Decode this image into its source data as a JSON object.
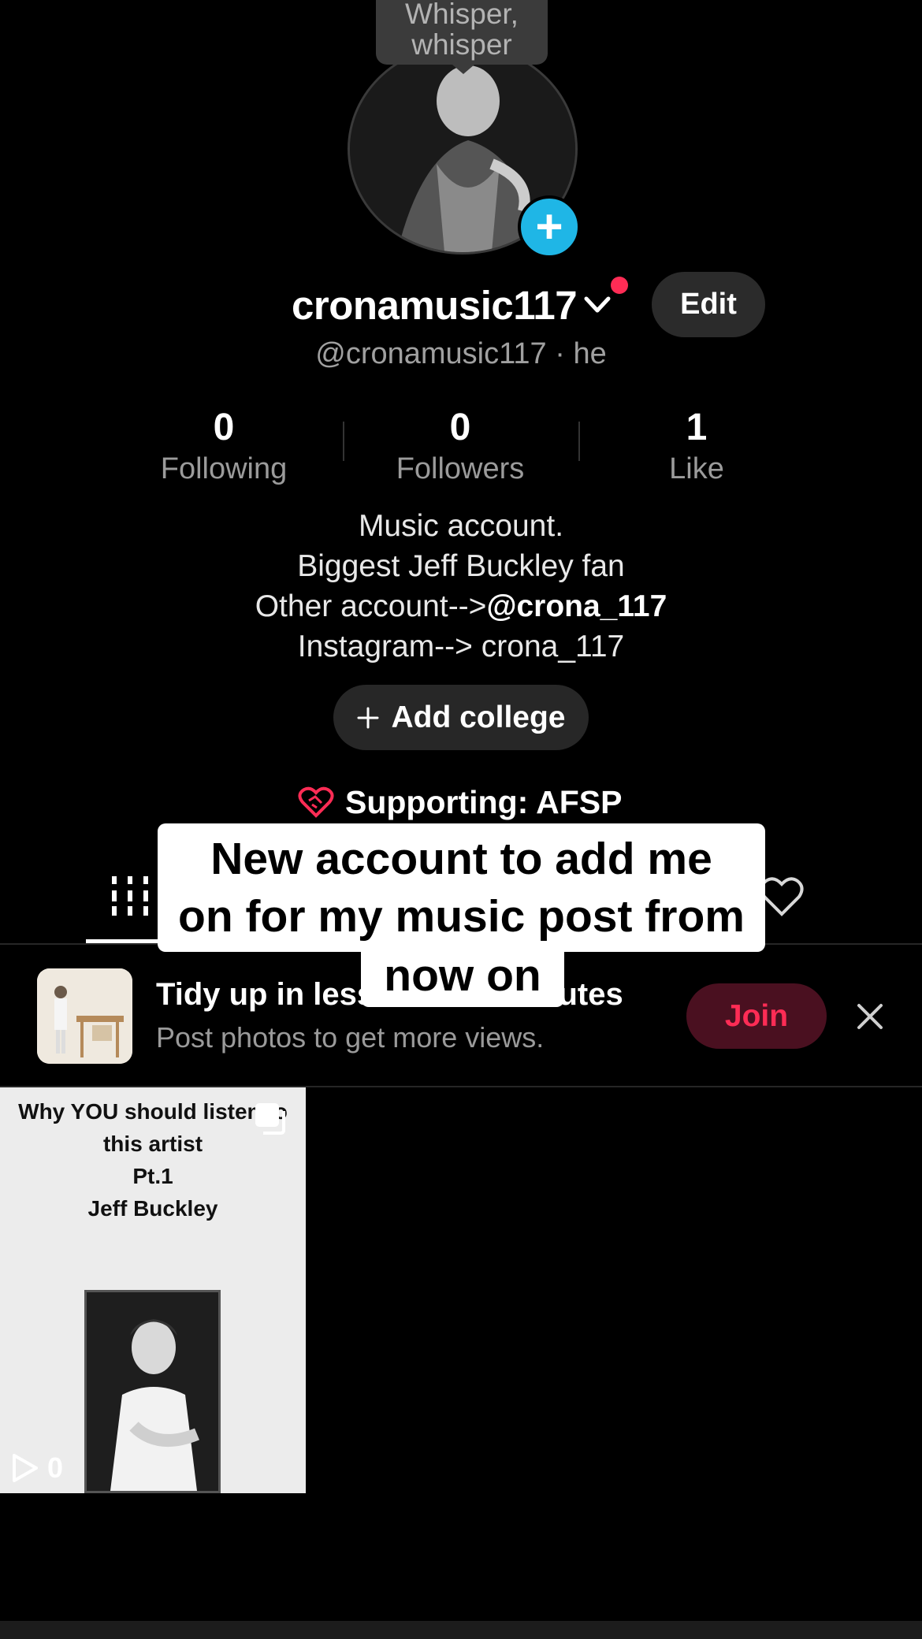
{
  "profile": {
    "note_bubble": "Whisper,\nwhisper",
    "username": "cronamusic117",
    "edit_label": "Edit",
    "handle_line": "@cronamusic117 · he"
  },
  "stats": [
    {
      "num": "0",
      "label": "Following"
    },
    {
      "num": "0",
      "label": "Followers"
    },
    {
      "num": "1",
      "label": "Like"
    }
  ],
  "bio": {
    "line1": "Music account.",
    "line2": "Biggest Jeff Buckley fan",
    "line3_prefix": "Other account-->",
    "line3_mention": "@crona_117",
    "line4": "Instagram--> crona_117"
  },
  "add_college_label": "Add college",
  "supporting_label": "Supporting: AFSP",
  "caption": {
    "line_a": "New account to add me",
    "line_b": "on for my music post from",
    "line_c": "now on"
  },
  "promo": {
    "title": "Tidy up in less than 10 minutes",
    "subtitle": "Post photos to get more views.",
    "join_label": "Join"
  },
  "video": {
    "line1": "Why YOU should listen to",
    "line2": "this artist",
    "line3": "Pt.1",
    "line4": "Jeff Buckley",
    "play_count": "0"
  },
  "colors": {
    "accent_red": "#fe2c55",
    "plus_blue": "#1fb6e6",
    "background": "#000000"
  }
}
